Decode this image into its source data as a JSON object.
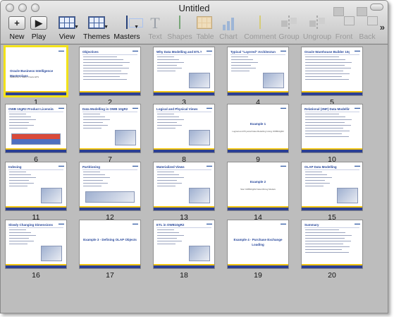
{
  "window": {
    "title": "Untitled"
  },
  "toolbar": {
    "items": [
      {
        "label": "New",
        "icon": "new-icon",
        "enabled": true
      },
      {
        "label": "Play",
        "icon": "play-icon",
        "enabled": true
      },
      {
        "label": "View",
        "icon": "view-icon",
        "enabled": true
      },
      {
        "label": "Themes",
        "icon": "themes-icon",
        "enabled": true
      },
      {
        "label": "Masters",
        "icon": "masters-icon",
        "enabled": true
      },
      {
        "label": "Text",
        "icon": "text-icon",
        "enabled": false
      },
      {
        "label": "Shapes",
        "icon": "shapes-icon",
        "enabled": false
      },
      {
        "label": "Table",
        "icon": "table-icon",
        "enabled": false
      },
      {
        "label": "Chart",
        "icon": "chart-icon",
        "enabled": false
      },
      {
        "label": "Comment",
        "icon": "comment-icon",
        "enabled": false
      },
      {
        "label": "Group",
        "icon": "group-icon",
        "enabled": false
      },
      {
        "label": "Ungroup",
        "icon": "ungroup-icon",
        "enabled": false
      },
      {
        "label": "Front",
        "icon": "front-icon",
        "enabled": false
      },
      {
        "label": "Back",
        "icon": "back-icon",
        "enabled": false
      }
    ],
    "overflow_icon": "chevron-double-right-icon"
  },
  "slides": [
    {
      "number": "1",
      "title": "Oracle Business Intelligence Masterclass",
      "subtitle": "Lawrence L. Mark, Oracle EPS",
      "kind": "title",
      "selected": true
    },
    {
      "number": "2",
      "title": "Objectives",
      "kind": "bullets"
    },
    {
      "number": "3",
      "title": "Why Data Modelling and ETL?",
      "kind": "bullets-image"
    },
    {
      "number": "4",
      "title": "Typical \"Layered\" Architecture",
      "kind": "diagram"
    },
    {
      "number": "5",
      "title": "Oracle Warehouse Builder 10gR2",
      "kind": "bullets"
    },
    {
      "number": "6",
      "title": "OWB 10gR2 Product Licensing",
      "kind": "bullets-red"
    },
    {
      "number": "7",
      "title": "Data Modelling in OWB 10gR2",
      "kind": "bullets-image"
    },
    {
      "number": "8",
      "title": "Logical and Physical Views",
      "kind": "bullets-image"
    },
    {
      "number": "9",
      "title": "Example 1",
      "subtitle": "Logical and Physical Data Modelling Using OWB10gR2",
      "kind": "section"
    },
    {
      "number": "10",
      "title": "Relational (3NF) Data Modelling",
      "kind": "bullets"
    },
    {
      "number": "11",
      "title": "Indexing",
      "kind": "bullets-image"
    },
    {
      "number": "12",
      "title": "Partitioning",
      "kind": "bullets-wide"
    },
    {
      "number": "13",
      "title": "Materialized Views",
      "kind": "bullets-image"
    },
    {
      "number": "14",
      "title": "Example 2",
      "subtitle": "Star OWB10gR2 Data Mining Models",
      "kind": "section"
    },
    {
      "number": "15",
      "title": "OLAP Data Modelling",
      "kind": "bullets-image"
    },
    {
      "number": "16",
      "title": "Slowly Changing Dimensions",
      "kind": "bullets-image"
    },
    {
      "number": "17",
      "title": "Example 3 - Defining OLAP Objects",
      "kind": "section"
    },
    {
      "number": "18",
      "title": "ETL in OWB10gR2",
      "kind": "bullets-image"
    },
    {
      "number": "19",
      "title": "Example 4 - Purchase Exchange Loading",
      "kind": "section"
    },
    {
      "number": "20",
      "title": "Summary",
      "kind": "bullets"
    }
  ]
}
